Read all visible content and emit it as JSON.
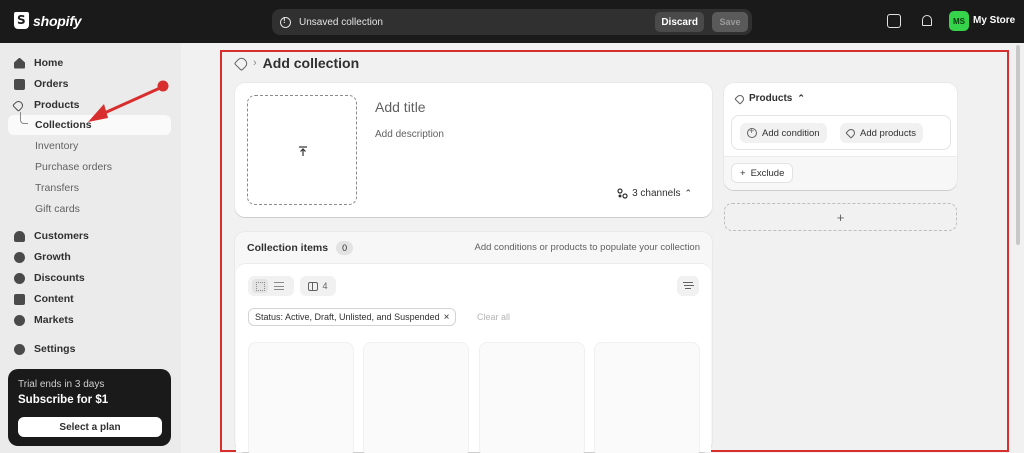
{
  "brand": {
    "name": "shopify"
  },
  "topbar": {
    "unsaved_message": "Unsaved collection",
    "discard_label": "Discard",
    "save_label": "Save",
    "avatar_initials": "MS",
    "store_name": "My Store",
    "avatar_color": "#36d44a"
  },
  "sidebar": {
    "items": [
      {
        "label": "Home",
        "icon": "home-icon"
      },
      {
        "label": "Orders",
        "icon": "inbox-icon"
      },
      {
        "label": "Products",
        "icon": "tag-icon"
      }
    ],
    "product_sub": [
      "Collections",
      "Inventory",
      "Purchase orders",
      "Transfers",
      "Gift cards"
    ],
    "items2": [
      {
        "label": "Customers",
        "icon": "person-icon"
      },
      {
        "label": "Growth",
        "icon": "growth-icon"
      },
      {
        "label": "Discounts",
        "icon": "discount-icon"
      },
      {
        "label": "Content",
        "icon": "content-icon"
      },
      {
        "label": "Markets",
        "icon": "globe-icon"
      }
    ],
    "settings_label": "Settings",
    "trial": {
      "ends": "Trial ends in 3 days",
      "subscribe": "Subscribe for $1",
      "button": "Select a plan"
    }
  },
  "main": {
    "page_title": "Add collection",
    "title_placeholder": "Add title",
    "description_placeholder": "Add description",
    "channels_label": "3 channels",
    "items": {
      "title": "Collection items",
      "count": "0",
      "hint": "Add conditions or products to populate your collection",
      "columns_count": "4",
      "status_filter": "Status: Active, Draft, Unlisted, and Suspended",
      "clear_all": "Clear all"
    },
    "conditions": {
      "type_label": "Products",
      "add_condition": "Add condition",
      "add_products": "Add products",
      "exclude": "Exclude",
      "add_section": "+"
    }
  },
  "colors": {
    "annotation": "#d92e2e",
    "topbar": "#1a1a1a"
  }
}
